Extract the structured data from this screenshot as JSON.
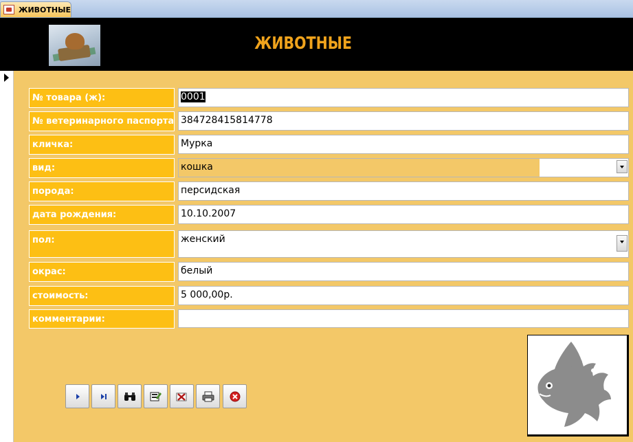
{
  "tab": {
    "label": "ЖИВОТНЫЕ",
    "icon": "form-icon"
  },
  "header": {
    "title": "ЖИВОТНЫЕ",
    "logo": "cat-in-basket-image"
  },
  "form": {
    "fields": [
      {
        "label": "№ товара (ж):",
        "value": "0001",
        "type": "text",
        "selected": true
      },
      {
        "label": "№ ветеринарного паспорта:",
        "value": "384728415814778",
        "type": "text"
      },
      {
        "label": "кличка:",
        "value": "Мурка",
        "type": "text"
      },
      {
        "label": "вид:",
        "value": "кошка",
        "type": "combo"
      },
      {
        "label": "порода:",
        "value": "персидская",
        "type": "text"
      },
      {
        "label": "дата рождения:",
        "value": "10.10.2007",
        "type": "text"
      },
      {
        "label": "пол:",
        "value": "женский",
        "type": "combo"
      },
      {
        "label": "окрас:",
        "value": "белый",
        "type": "text"
      },
      {
        "label": "стоимость:",
        "value": "5 000,00р.",
        "type": "text"
      },
      {
        "label": "комментарии:",
        "value": "",
        "type": "text"
      }
    ]
  },
  "toolbar": {
    "buttons": [
      {
        "name": "next-record-button",
        "icon": "next-record-icon"
      },
      {
        "name": "last-record-button",
        "icon": "last-record-icon"
      },
      {
        "name": "find-record-button",
        "icon": "binoculars-icon"
      },
      {
        "name": "save-record-button",
        "icon": "save-record-icon"
      },
      {
        "name": "delete-record-button",
        "icon": "delete-record-icon"
      },
      {
        "name": "print-button",
        "icon": "printer-icon"
      },
      {
        "name": "close-form-button",
        "icon": "close-icon"
      }
    ]
  },
  "picture": {
    "icon": "fish-silhouette-icon"
  },
  "colors": {
    "form_bg": "#f3c868",
    "label_bg": "#fdbf14",
    "title": "#f0a31c"
  }
}
